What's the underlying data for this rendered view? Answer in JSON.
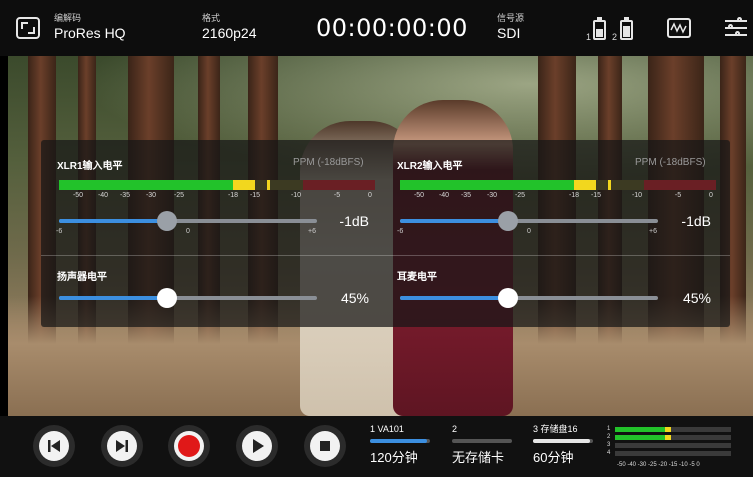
{
  "topbar": {
    "codec_label": "编解码",
    "codec_value": "ProRes HQ",
    "format_label": "格式",
    "format_value": "2160p24",
    "timecode": "00:00:00:00",
    "source_label": "信号源",
    "source_value": "SDI",
    "battery1_label": "1",
    "battery2_label": "2",
    "battery1_level": 0.55,
    "battery2_level": 0.8
  },
  "audio": {
    "xlr1": {
      "label": "XLR1输入电平",
      "meter_mode": "PPM (-18dBFS)",
      "scale": [
        "-50",
        "-40",
        "-35",
        "-30",
        "-25",
        "-18",
        "-15",
        "-10",
        "-5",
        "0"
      ],
      "slider_min": "-6",
      "slider_mid": "0",
      "slider_max": "+6",
      "value": "-1dB",
      "slider_level": 0.42
    },
    "xlr2": {
      "label": "XLR2输入电平",
      "meter_mode": "PPM (-18dBFS)",
      "scale": [
        "-50",
        "-40",
        "-35",
        "-30",
        "-25",
        "-18",
        "-15",
        "-10",
        "-5",
        "0"
      ],
      "slider_min": "-6",
      "slider_mid": "0",
      "slider_max": "+6",
      "value": "-1dB",
      "slider_level": 0.42
    },
    "speaker": {
      "label": "扬声器电平",
      "value": "45%",
      "slider_level": 0.45
    },
    "headphone": {
      "label": "耳麦电平",
      "value": "45%",
      "slider_level": 0.45
    }
  },
  "transport": {
    "buttons": [
      "skip-back",
      "skip-forward",
      "record",
      "play",
      "stop"
    ],
    "record_color": "#e01818"
  },
  "media": [
    {
      "label": "1  VA101",
      "value": "120分钟",
      "fill": 0.95,
      "color": "#3c8fe0"
    },
    {
      "label": "2",
      "value": "无存储卡",
      "fill": 0,
      "color": "#555555"
    },
    {
      "label": "3 存储盘16",
      "value": "60分钟",
      "fill": 0.95,
      "color": "#e6e6e6"
    }
  ],
  "mini_meter": {
    "channels": [
      "1",
      "2",
      "3",
      "4"
    ],
    "scale": "-50 -40  -30 -25 -20  -15  -10   -5   0"
  },
  "colors": {
    "meter_green": "#22c22a",
    "meter_yellow": "#f2d71e",
    "meter_red": "#6a1f24",
    "accent_blue": "#3c8fe0"
  }
}
